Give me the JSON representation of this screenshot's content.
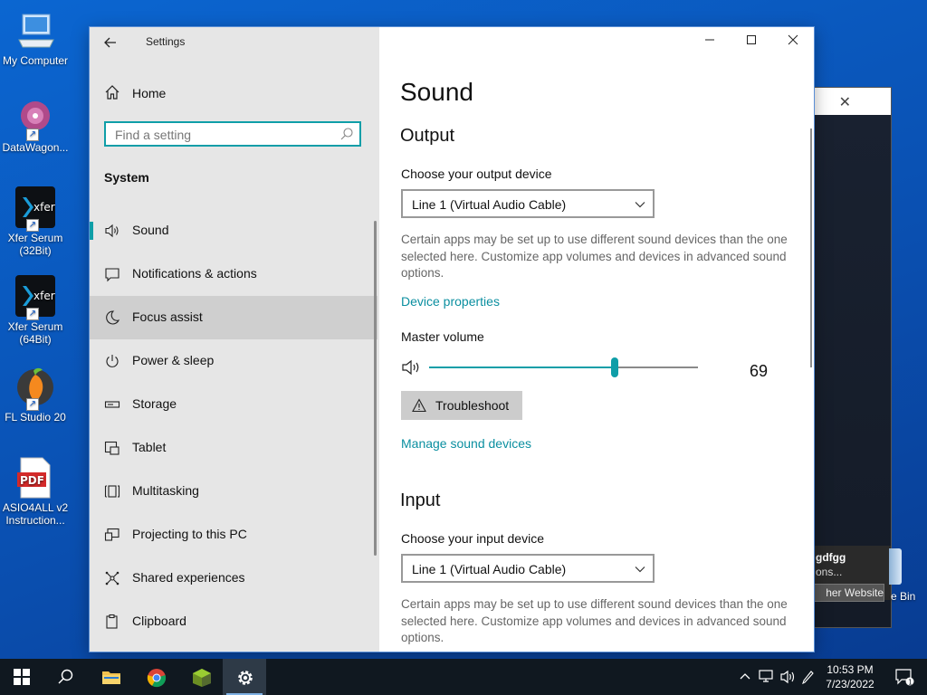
{
  "desktop": {
    "icons": [
      {
        "label": "My Computer"
      },
      {
        "label": "DataWagon..."
      },
      {
        "label": "Xfer Serum (32Bit)"
      },
      {
        "label": "Xfer Serum (64Bit)"
      },
      {
        "label": "FL Studio 20"
      },
      {
        "label": "ASIO4ALL v2 Instruction..."
      }
    ],
    "background_window": {
      "notice_title": "gdfgg",
      "notice_text": "ons...",
      "button_label": "her Website"
    },
    "recycle_bin_label": "e Bin"
  },
  "settings": {
    "app_title": "Settings",
    "home_label": "Home",
    "search": {
      "placeholder": "Find a setting",
      "value": ""
    },
    "section_label": "System",
    "nav_items": [
      {
        "label": "Sound",
        "icon": "speaker-icon",
        "selected": true
      },
      {
        "label": "Notifications & actions",
        "icon": "notification-icon"
      },
      {
        "label": "Focus assist",
        "icon": "moon-icon",
        "hover": true
      },
      {
        "label": "Power & sleep",
        "icon": "power-icon"
      },
      {
        "label": "Storage",
        "icon": "storage-icon"
      },
      {
        "label": "Tablet",
        "icon": "tablet-icon"
      },
      {
        "label": "Multitasking",
        "icon": "multitasking-icon"
      },
      {
        "label": "Projecting to this PC",
        "icon": "projecting-icon"
      },
      {
        "label": "Shared experiences",
        "icon": "shared-icon"
      },
      {
        "label": "Clipboard",
        "icon": "clipboard-icon"
      }
    ],
    "page_title": "Sound",
    "output": {
      "heading": "Output",
      "device_label": "Choose your output device",
      "device_value": "Line 1 (Virtual Audio Cable)",
      "description": "Certain apps may be set up to use different sound devices than the one selected here. Customize app volumes and devices in advanced sound options.",
      "device_properties_link": "Device properties",
      "master_volume_label": "Master volume",
      "volume": 69,
      "troubleshoot_label": "Troubleshoot",
      "manage_link": "Manage sound devices"
    },
    "input": {
      "heading": "Input",
      "device_label": "Choose your input device",
      "device_value": "Line 1 (Virtual Audio Cable)",
      "description": "Certain apps may be set up to use different sound devices than the one selected here. Customize app volumes and devices in advanced sound options."
    }
  },
  "taskbar": {
    "time": "10:53 PM",
    "date": "7/23/2022",
    "notification_count": "1"
  },
  "colors": {
    "accent": "#0f9ea8",
    "link": "#0b8fa0",
    "taskbar": "#101820"
  }
}
